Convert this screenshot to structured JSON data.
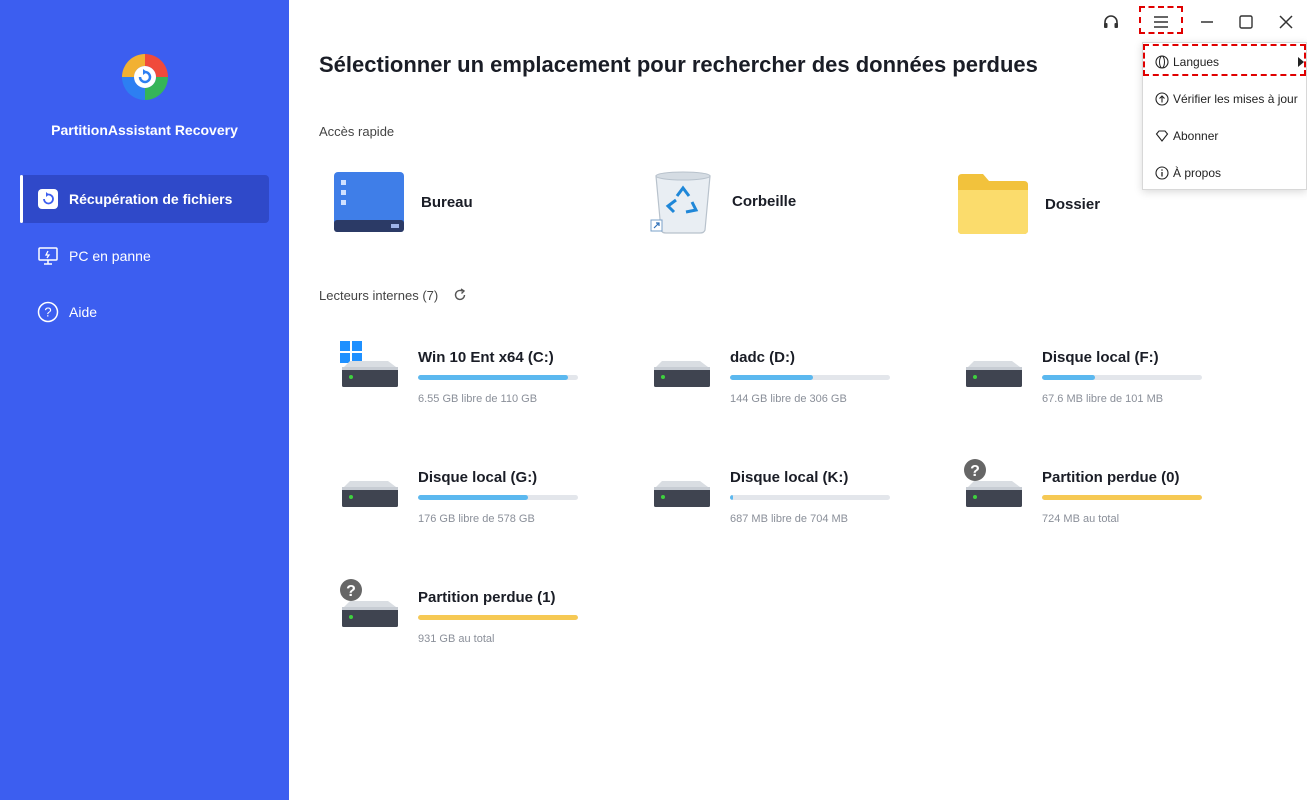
{
  "app": {
    "name": "PartitionAssistant Recovery"
  },
  "sidebar": {
    "items": [
      {
        "label": "Récupération de fichiers",
        "icon": "restore-icon",
        "active": true
      },
      {
        "label": "PC en panne",
        "icon": "monitor-icon",
        "active": false
      },
      {
        "label": "Aide",
        "icon": "help-icon",
        "active": false
      }
    ]
  },
  "main": {
    "title": "Sélectionner un emplacement pour rechercher des données perdues",
    "quick_access": {
      "label": "Accès rapide",
      "items": [
        {
          "label": "Bureau",
          "icon": "desktop-icon"
        },
        {
          "label": "Corbeille",
          "icon": "recycle-bin-icon"
        },
        {
          "label": "Dossier",
          "icon": "folder-icon"
        }
      ]
    },
    "drives": {
      "label": "Lecteurs internes (7)",
      "items": [
        {
          "name": "Win 10 Ent x64 (C:)",
          "info": "6.55 GB libre de 110 GB",
          "used": 0.94,
          "lost": false
        },
        {
          "name": "dadc (D:)",
          "info": "144 GB libre de 306 GB",
          "used": 0.52,
          "lost": false
        },
        {
          "name": "Disque local (F:)",
          "info": "67.6 MB libre de 101 MB",
          "used": 0.33,
          "lost": false
        },
        {
          "name": "Disque local (G:)",
          "info": "176 GB libre de 578 GB",
          "used": 0.69,
          "lost": false
        },
        {
          "name": "Disque local (K:)",
          "info": "687 MB libre de 704 MB",
          "used": 0.02,
          "lost": false
        },
        {
          "name": "Partition perdue (0)",
          "info": "724 MB au total",
          "used": 1.0,
          "lost": true
        },
        {
          "name": "Partition perdue (1)",
          "info": "931 GB au total",
          "used": 1.0,
          "lost": true
        }
      ]
    }
  },
  "menu": {
    "items": [
      {
        "label": "Langues",
        "icon": "globe-icon"
      },
      {
        "label": "Vérifier les mises à jour",
        "icon": "update-icon"
      },
      {
        "label": "Abonner",
        "icon": "diamond-icon"
      },
      {
        "label": "À propos",
        "icon": "info-icon"
      }
    ]
  },
  "colors": {
    "sidebar": "#3c5ef0",
    "active": "#2f49c9",
    "bar": "#5bb8ef",
    "lost_bar": "#f6c954",
    "highlight": "#e00000"
  }
}
